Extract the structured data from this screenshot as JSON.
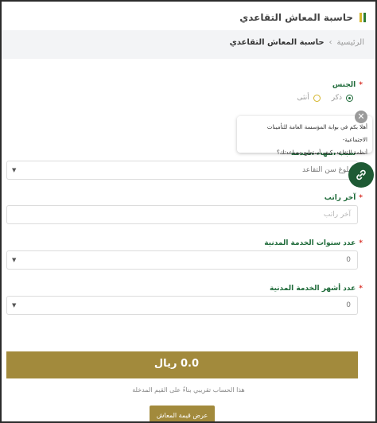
{
  "header": {
    "title": "حاسبة المعاش التقاعدي",
    "accent_colors": [
      "#2e7d32",
      "#d4b52a"
    ]
  },
  "breadcrumb": {
    "home": "الرئيسية",
    "separator": "›",
    "current": "حاسبة المعاش التقاعدي"
  },
  "form": {
    "gender": {
      "label": "الجنس",
      "options": [
        {
          "label": "ذكر",
          "checked": true
        },
        {
          "label": "أنثى",
          "checked": false
        }
      ]
    },
    "service_type": {
      "label": "سبب انتهاء الخدمة",
      "value": "بلوغ سن التقاعد",
      "caret": "▼"
    },
    "last_salary": {
      "label": "آخر راتب",
      "placeholder": "آخر راتب"
    },
    "civil_years": {
      "label": "عدد سنوات الخدمة المدنية",
      "value": "0",
      "caret": "▼"
    },
    "civil_months": {
      "label": "عدد أشهر الخدمة المدنية",
      "value": "0",
      "caret": "▼"
    },
    "required_mark": "*"
  },
  "chat": {
    "message_line1": "أهلا بكم في بوابة المؤسسة العامة للتأمينات الاجتماعية-",
    "message_line2": "أنظمة التقاعد، كيف أستطيع مساعدتك؟",
    "close_glyph": "✕",
    "fab_icon": "chat-link-icon"
  },
  "result": {
    "value": "0.0 ريال",
    "note": "هذا الحساب تقريبي بناءً على القيم المدخلة",
    "button_label": "عرض قيمة المعاش"
  },
  "colors": {
    "primary_green": "#1f6b3a",
    "gold": "#a28a3c",
    "required_red": "#d9342b"
  }
}
